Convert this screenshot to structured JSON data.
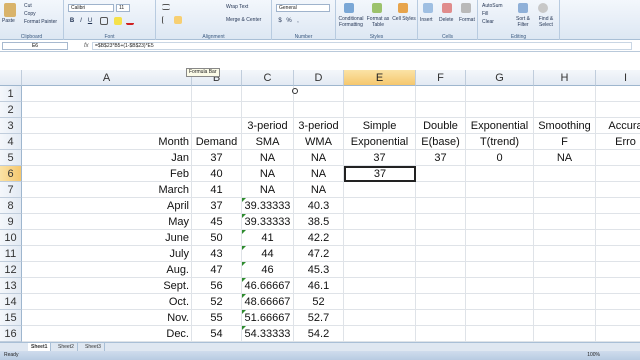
{
  "ribbon": {
    "clipboard": {
      "label": "Clipboard",
      "paste": "Paste",
      "cut": "Cut",
      "copy": "Copy",
      "format_painter": "Format Painter"
    },
    "font": {
      "label": "Font",
      "name": "Calibri",
      "size": "11",
      "bold": "B",
      "italic": "I",
      "underline": "U"
    },
    "alignment": {
      "label": "Alignment",
      "wrap": "Wrap Text",
      "merge": "Merge & Center"
    },
    "number": {
      "label": "Number",
      "format": "General",
      "currency": "$",
      "percent": "%",
      "comma": ","
    },
    "styles": {
      "label": "Styles",
      "conditional": "Conditional Formatting",
      "format_table": "Format as Table",
      "cell_styles": "Cell Styles"
    },
    "cells": {
      "label": "Cells",
      "insert": "Insert",
      "delete": "Delete",
      "format": "Format"
    },
    "editing": {
      "label": "Editing",
      "autosum": "AutoSum",
      "fill": "Fill",
      "clear": "Clear",
      "sort": "Sort & Filter",
      "find": "Find & Select"
    }
  },
  "formula_bar": {
    "name_box": "E6",
    "fx": "fx",
    "formula": "=$B$23*B5+(1-$B$23)*E5",
    "tooltip": "Formula Bar"
  },
  "columns": [
    "A",
    "B",
    "C",
    "D",
    "E",
    "F",
    "G",
    "H",
    "I"
  ],
  "rows": [
    "1",
    "2",
    "3",
    "4",
    "5",
    "6",
    "7",
    "8",
    "9",
    "10",
    "11",
    "12",
    "13",
    "14",
    "15",
    "16"
  ],
  "selected": {
    "col": "E",
    "row": "6"
  },
  "cells": {
    "r3": {
      "C": "3-period",
      "D": "3-period",
      "E": "Simple",
      "F": "Double",
      "G": "Exponential",
      "H": "Smoothing",
      "I": "Accura"
    },
    "r4": {
      "A": "Month",
      "B": "Demand",
      "C": "SMA",
      "D": "WMA",
      "E": "Exponential",
      "F": "E(base)",
      "G": "T(trend)",
      "H": "F",
      "I": "Erro"
    },
    "data": [
      {
        "A": "Jan",
        "B": "37",
        "C": "NA",
        "D": "NA",
        "E": "37",
        "F": "37",
        "G": "0",
        "H": "NA"
      },
      {
        "A": "Feb",
        "B": "40",
        "C": "NA",
        "D": "NA",
        "E": "37",
        "F": "",
        "G": "",
        "H": ""
      },
      {
        "A": "March",
        "B": "41",
        "C": "NA",
        "D": "NA",
        "E": "",
        "F": "",
        "G": "",
        "H": ""
      },
      {
        "A": "April",
        "B": "37",
        "C": "39.33333",
        "D": "40.3",
        "E": "",
        "F": "",
        "G": "",
        "H": ""
      },
      {
        "A": "May",
        "B": "45",
        "C": "39.33333",
        "D": "38.5",
        "E": "",
        "F": "",
        "G": "",
        "H": ""
      },
      {
        "A": "June",
        "B": "50",
        "C": "41",
        "D": "42.2",
        "E": "",
        "F": "",
        "G": "",
        "H": ""
      },
      {
        "A": "July",
        "B": "43",
        "C": "44",
        "D": "47.2",
        "E": "",
        "F": "",
        "G": "",
        "H": ""
      },
      {
        "A": "Aug.",
        "B": "47",
        "C": "46",
        "D": "45.3",
        "E": "",
        "F": "",
        "G": "",
        "H": ""
      },
      {
        "A": "Sept.",
        "B": "56",
        "C": "46.66667",
        "D": "46.1",
        "E": "",
        "F": "",
        "G": "",
        "H": ""
      },
      {
        "A": "Oct.",
        "B": "52",
        "C": "48.66667",
        "D": "52",
        "E": "",
        "F": "",
        "G": "",
        "H": ""
      },
      {
        "A": "Nov.",
        "B": "55",
        "C": "51.66667",
        "D": "52.7",
        "E": "",
        "F": "",
        "G": "",
        "H": ""
      },
      {
        "A": "Dec.",
        "B": "54",
        "C": "54.33333",
        "D": "54.2",
        "E": "",
        "F": "",
        "G": "",
        "H": ""
      }
    ]
  },
  "sheets": [
    "Sheet1",
    "Sheet2",
    "Sheet3"
  ],
  "active_sheet": "Sheet1",
  "status": {
    "ready": "Ready",
    "zoom": "100%"
  },
  "colors": {
    "selection": "#f5c76e",
    "ribbon": "#dde7f3",
    "error_triangle": "#2e8b2e"
  }
}
